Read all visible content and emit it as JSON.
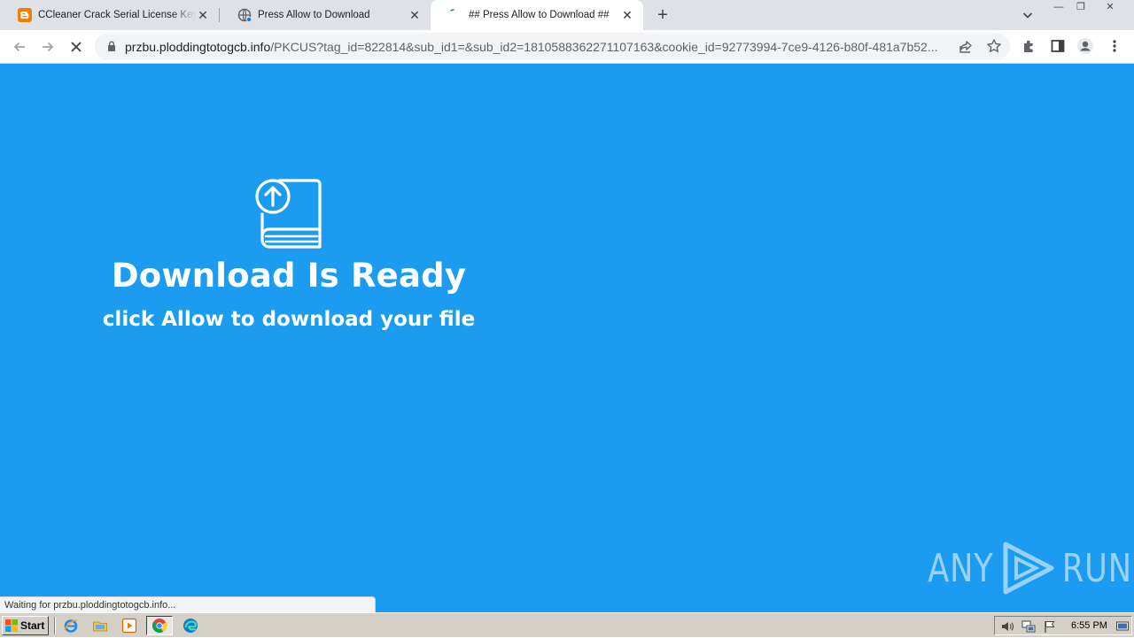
{
  "tabs": [
    {
      "title": "CCleaner Crack Serial License Key Free",
      "favicon": "blogger-icon",
      "active": false
    },
    {
      "title": "Press Allow to Download",
      "favicon": "globe-icon",
      "active": false
    },
    {
      "title": "## Press Allow to Download ##",
      "favicon": "loading-icon",
      "active": true
    }
  ],
  "tab_close_glyph": "✕",
  "new_tab_glyph": "+",
  "window_controls": {
    "minimize": "—",
    "restore": "❐",
    "close": "✕"
  },
  "address_bar": {
    "host": "przbu.ploddingtotogcb.info",
    "path": "/PKCUS?tag_id=822814&sub_id1=&sub_id2=1810588362271107163&cookie_id=92773994-7ce9-4126-b80f-481a7b52..."
  },
  "page": {
    "title": "Download Is Ready",
    "subtitle": "click Allow to download your file",
    "background_color": "#1c9cf1"
  },
  "status_text": "Waiting for przbu.ploddingtotogcb.info...",
  "watermark": {
    "left": "ANY",
    "right": "RUN"
  },
  "taskbar": {
    "start_label": "Start",
    "clock": "6:55 PM"
  }
}
